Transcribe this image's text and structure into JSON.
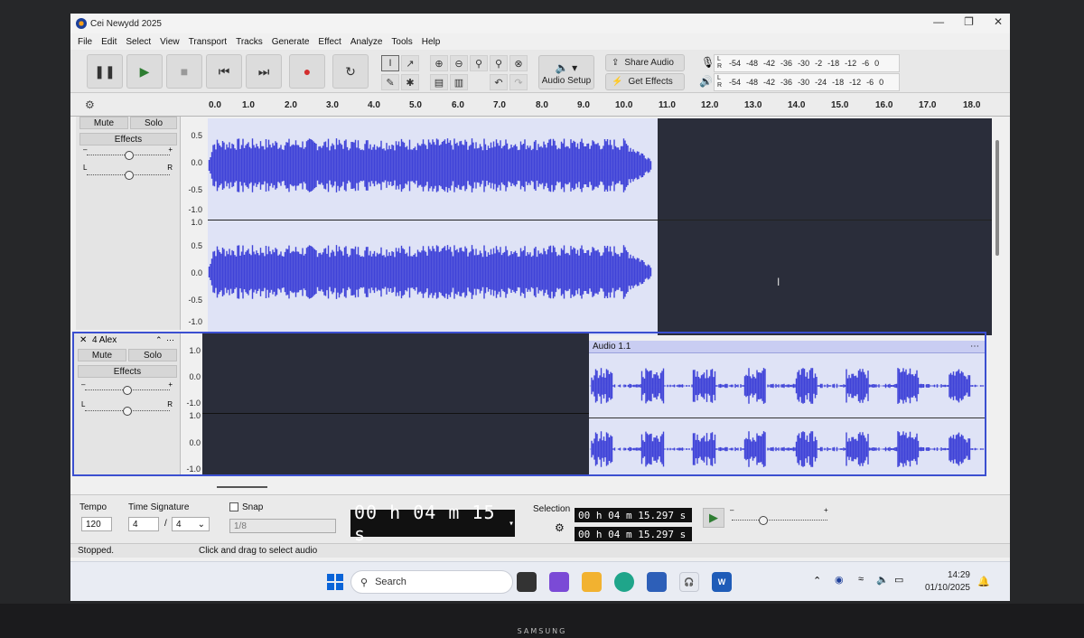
{
  "window": {
    "title": "Cei Newydd 2025"
  },
  "menu": [
    "File",
    "Edit",
    "Select",
    "View",
    "Transport",
    "Tracks",
    "Generate",
    "Effect",
    "Analyze",
    "Tools",
    "Help"
  ],
  "toolbar": {
    "audio_setup_label": "Audio Setup",
    "share_audio_label": "Share Audio",
    "get_effects_label": "Get Effects",
    "record_meter_ticks": [
      "-54",
      "-48",
      "-42",
      "-36",
      "-30",
      "-2",
      "-18",
      "-12",
      "-6",
      "0"
    ],
    "playback_meter_ticks": [
      "-54",
      "-48",
      "-42",
      "-36",
      "-30",
      "-24",
      "-18",
      "-12",
      "-6",
      "0"
    ]
  },
  "ruler": {
    "ticks": [
      "0.0",
      "1.0",
      "2.0",
      "3.0",
      "4.0",
      "5.0",
      "6.0",
      "7.0",
      "8.0",
      "9.0",
      "10.0",
      "11.0",
      "12.0",
      "13.0",
      "14.0",
      "15.0",
      "16.0",
      "17.0",
      "18.0"
    ]
  },
  "track1": {
    "mute_label": "Mute",
    "solo_label": "Solo",
    "effects_label": "Effects",
    "scale_top": [
      "0.5",
      "0.0",
      "-0.5",
      "-1.0"
    ],
    "scale_bottom": [
      "1.0",
      "0.5",
      "0.0",
      "-0.5",
      "-1.0"
    ]
  },
  "track2": {
    "name": "4 Alex",
    "mute_label": "Mute",
    "solo_label": "Solo",
    "effects_label": "Effects",
    "clip_name": "Audio 1.1",
    "scale_top": [
      "1.0",
      "0.0",
      "-1.0"
    ],
    "scale_bottom": [
      "1.0",
      "0.0",
      "-1.0"
    ]
  },
  "bottom": {
    "tempo_label": "Tempo",
    "tempo_value": "120",
    "time_sig_label": "Time Signature",
    "time_sig_num": "4",
    "time_sig_den": "4",
    "snap_label": "Snap",
    "snap_value": "1/8",
    "time_display": "00 h 04 m 15 s",
    "selection_label": "Selection",
    "selection_start": "00 h 04 m 15.297 s",
    "selection_end": "00 h 04 m 15.297 s"
  },
  "status": {
    "state": "Stopped.",
    "hint": "Click and drag to select audio"
  },
  "taskbar": {
    "search_placeholder": "Search",
    "time": "14:29",
    "date": "01/10/2025"
  },
  "monitor": {
    "brand": "SAMSUNG"
  },
  "colors": {
    "waveform": "#3f43d8",
    "dark_track": "#2a2d3a",
    "clip_bg": "#dfe3f6"
  }
}
